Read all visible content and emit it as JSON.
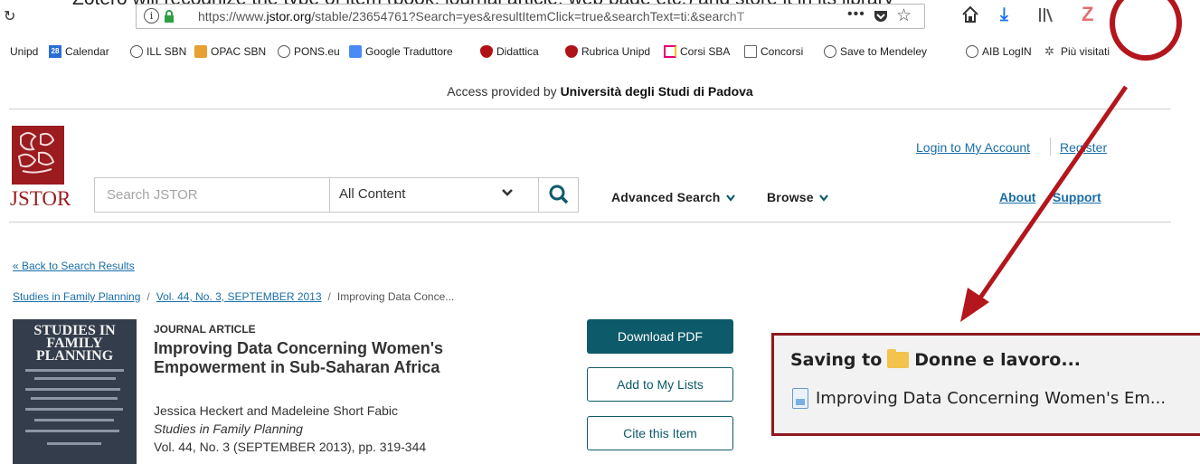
{
  "caption": {
    "text": "Zotero will recognize the type of item (book, journal article, web page etc.) and store it in its library"
  },
  "browser": {
    "url_prefix": "https://www.",
    "url_host": "jstor.org",
    "url_path": "/stable/23654761?Search=yes&resultItemClick=true&searchText=ti:&searchT",
    "menu_dots": "•••",
    "zotero_icon": "Z",
    "bookmarks": [
      "Unipd",
      "Calendar",
      "ILL SBN",
      "OPAC SBN",
      "PONS.eu",
      "Google Traduttore",
      "Didattica",
      "Rubrica Unipd",
      "Corsi SBA",
      "Concorsi",
      "Save to Mendeley",
      "AIB LogIN",
      "Più visitati"
    ],
    "calendar_day": "28"
  },
  "access": {
    "prefix": "Access provided by ",
    "institution": "Università degli Studi di Padova"
  },
  "header": {
    "logo": "JSTOR",
    "search_placeholder": "Search JSTOR",
    "search_scope": "All Content",
    "advanced_search": "Advanced Search",
    "browse": "Browse",
    "login": "Login to My Account",
    "register": "Register",
    "about": "About",
    "support": "Support"
  },
  "article": {
    "back_link": "« Back to Search Results",
    "breadcrumb": [
      "Studies in Family Planning",
      "Vol. 44, No. 3, SEPTEMBER 2013",
      "Improving Data Conce..."
    ],
    "cover_title": "STUDIES IN FAMILY PLANNING",
    "type": "JOURNAL ARTICLE",
    "title": "Improving Data Concerning Women's Empowerment in Sub-Saharan Africa",
    "authors": "Jessica Heckert and Madeleine Short Fabic",
    "journal": "Studies in Family Planning",
    "volume": "Vol. 44, No. 3 (SEPTEMBER 2013), pp. 319-344"
  },
  "actions": {
    "download": "Download PDF",
    "add_lists": "Add to My Lists",
    "cite": "Cite this Item"
  },
  "zotero_popup": {
    "saving_label": "Saving to",
    "folder": "Donne e lavoro...",
    "item": "Improving Data Concerning Women's Em..."
  },
  "colors": {
    "jstor_red": "#9b1b1f",
    "button_teal": "#0d5a6b",
    "link_blue": "#1a6ea8",
    "annotation_red": "#b3161c"
  }
}
